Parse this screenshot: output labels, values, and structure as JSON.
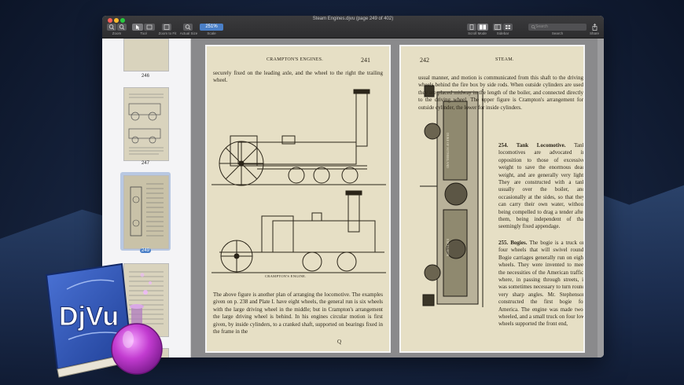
{
  "window": {
    "title": "Steam Engines.djvu (page 249 of 402)"
  },
  "toolbar": {
    "zoom_label": "Zoom",
    "tool_label": "Tool",
    "zoom_to_fit_label": "Zoom to Fit",
    "actual_size_label": "Actual Size",
    "scale_label": "Scale",
    "scale_value": "251%",
    "scroll_mode_label": "Scroll Mode",
    "sidebar_label": "Sidebar",
    "search_label": "Search",
    "search_placeholder": "Search",
    "share_label": "Share"
  },
  "sidebar": {
    "thumbnails": [
      {
        "label": "246"
      },
      {
        "label": "247"
      },
      {
        "label": "249",
        "selected": true
      },
      {
        "label": ""
      }
    ]
  },
  "left_page": {
    "header": "CRAMPTON'S ENGINES.",
    "number": "241",
    "top_text": "securely fixed on the leading axle, and the wheel to the right the trailing wheel.",
    "caption": "CRAMPTON'S ENGINE.",
    "body_text": "The above figure is another plan of arranging the locomotive. The examples given on p. 238 and Plate I. have eight wheels, the general run is six wheels with the large driving wheel in the middle; but in Crampton's arrangement the large driving wheel is behind. In his engines circular motion is first given, by inside cylinders, to a cranked shaft, supported on bearings fixed in the frame in the",
    "signature": "Q"
  },
  "right_page": {
    "number": "242",
    "header": "STEAM.",
    "top_text": "usual manner, and motion is communicated from this shaft to the driving wheels behind the fire box by side rods. When outside cylinders are used they are placed midway in the length of the boiler, and connected directly to the driving wheel. The upper figure is Crampton's arrangement for outside cylinder, the lower for inside cylinders.",
    "section1_title": "254. Tank Locomotive.",
    "section1_text": "Tank locomotives are advocated in opposition to those of excessive weight to save the enormous dead weight, and are generally very light. They are constructed with a tank usually over the boiler, and occasionally at the sides, so that they can carry their own water, without being compelled to drag a tender after them, being independent of that seemingly fixed appendage.",
    "section2_title": "255. Bogies.",
    "section2_text": "The bogie is a truck on four wheels that will swivel round. Bogie carriages generally run on eight wheels. They were invented to meet the necessities of the American traffic, where, in passing through streets, it was sometimes necessary to turn round very sharp angles. Mr. Stephenson constructed the first bogie for America. The engine was made two-wheeled, and a small truck on four low wheels supported the front end,",
    "engine_label_top": "DUKE OF SUTHERLAND",
    "engine_label_bottom": "EXCELSIOR"
  },
  "app_icon": {
    "text": "DjVu"
  },
  "colors": {
    "accent": "#4a7fc7",
    "paper": "#e6dfc5",
    "ink": "#2b2519",
    "book_blue": "#2f56b5",
    "flask_purple": "#c23bd0"
  }
}
